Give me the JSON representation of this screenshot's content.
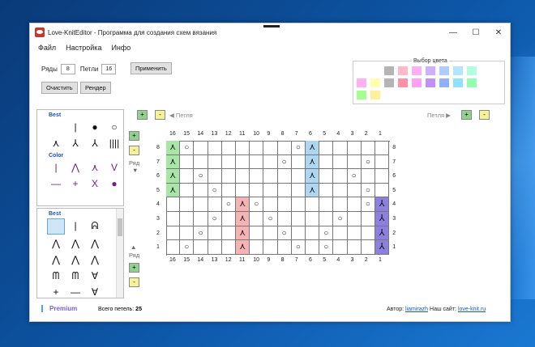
{
  "window": {
    "title": "Love-KnitEditor - Программа для создания схем вязания",
    "controls": [
      "—",
      "☐",
      "✕"
    ]
  },
  "menu": [
    "Файл",
    "Настройка",
    "Инфо"
  ],
  "toolbar": {
    "rows_label": "Ряды",
    "rows_value": "8",
    "loops_label": "Петли",
    "loops_value": "16",
    "apply": "Применить",
    "clear": "Очистить",
    "render": "Рендер"
  },
  "palette": {
    "title": "Выбор цвета",
    "colors": [
      "#ffffff",
      "#ffffff",
      "#b5b5b5",
      "#ffb9c8",
      "#ffb0f0",
      "#cfb0ff",
      "#b0ccff",
      "#b0e6ff",
      "#b0ffe0",
      "#ffffff",
      "#ffb0f0",
      "#ffffb0",
      "#b5b5b5",
      "#ff90a8",
      "#ffa0f0",
      "#c090ff",
      "#90b0ff",
      "#90e0ff",
      "#90ffb0",
      "#ffffff",
      "#a8ff90",
      "#fff09a",
      "#ffffff",
      "#ffffff",
      "#ffffff",
      "#ffffff",
      "#ffffff",
      "#ffffff",
      "#ffffff",
      "#ffffff"
    ]
  },
  "panel1": {
    "best": "Best",
    "best_symbols": [
      "",
      "|",
      "●",
      "○",
      "⋏",
      "⅄",
      "⅄",
      "||||"
    ],
    "color": "Color",
    "color_symbols": [
      "|",
      "⋀",
      "⋏",
      "V",
      "—",
      "+",
      "X",
      "●"
    ]
  },
  "panel2": {
    "best": "Best",
    "symbols": [
      "",
      "|",
      "ᕱ",
      "",
      "⋀",
      "⋀",
      "⋀",
      "",
      "⋀",
      "⋀",
      "⋀",
      "",
      "ᗰ",
      "ᗰ",
      "∀",
      "",
      "+",
      "—",
      "∀",
      ""
    ]
  },
  "nav": {
    "row_label": "Ряд",
    "loop_left": "◀ Петля",
    "loop_right": "Петля ▶",
    "plus": "+",
    "minus": "-"
  },
  "grid": {
    "cols": [
      "16",
      "15",
      "14",
      "13",
      "12",
      "11",
      "10",
      "9",
      "8",
      "7",
      "6",
      "5",
      "4",
      "3",
      "2",
      "1"
    ],
    "rows": [
      "8",
      "7",
      "6",
      "5",
      "4",
      "3",
      "2",
      "1"
    ]
  },
  "status": {
    "premium": "Premium",
    "total_label": "Всего петель:",
    "total_value": "25",
    "author_label": "Автор:",
    "author_link": "liamirazh",
    "site_label": "Наш сайт:",
    "site_link": "love-knit.ru"
  }
}
